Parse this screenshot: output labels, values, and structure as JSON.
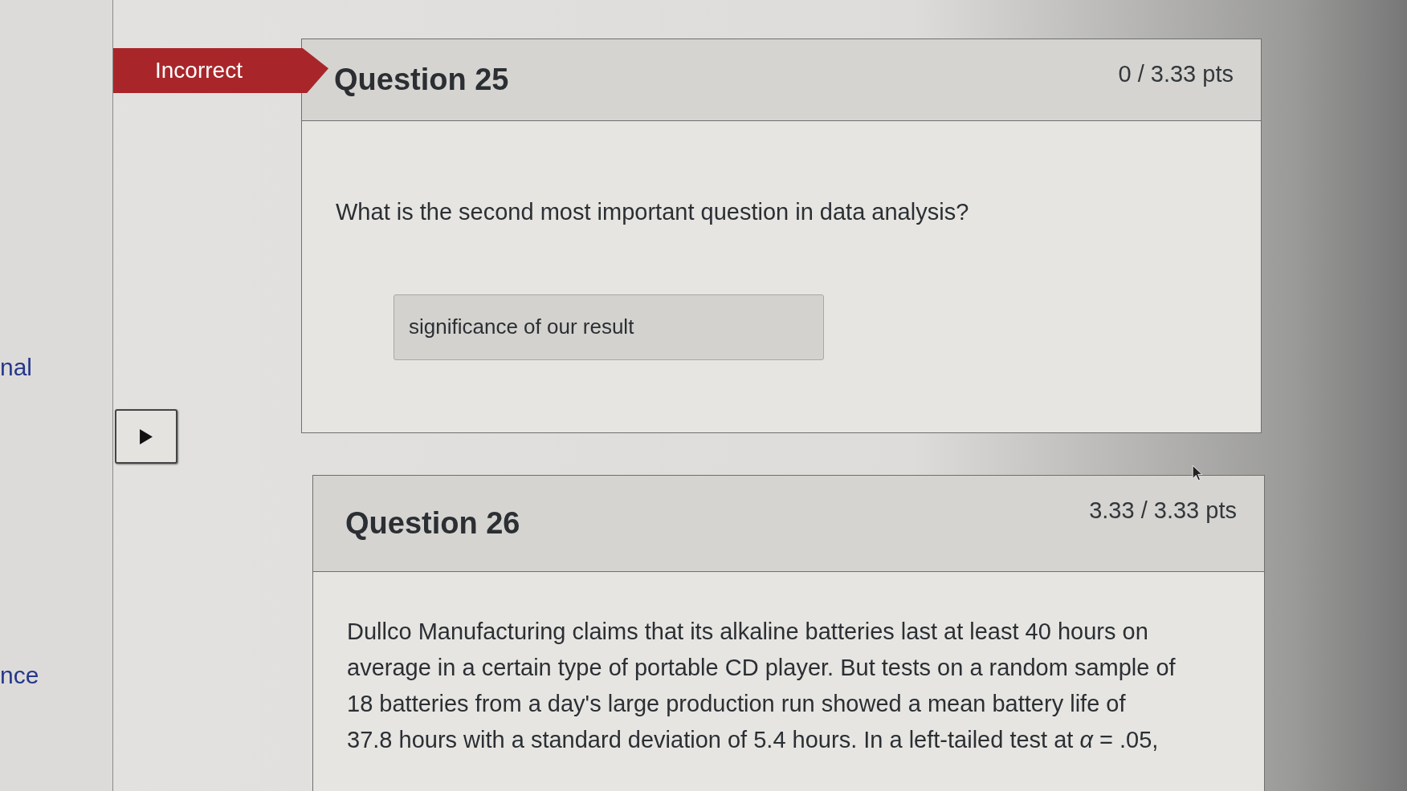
{
  "sidebar": {
    "links": [
      "nal",
      "nce"
    ]
  },
  "questions": [
    {
      "title": "Question 25",
      "points": "0 / 3.33 pts",
      "result_badge": "Incorrect",
      "text": "What is the second most important question in data analysis?",
      "answer": "significance of our result"
    },
    {
      "title": "Question 26",
      "points": "3.33 / 3.33 pts",
      "text": "Dullco Manufacturing claims that its alkaline batteries last at least 40 hours on average in a certain type of portable CD player. But tests on a random sample of 18 batteries from a day's large production run showed a mean battery life of 37.8 hours with a standard deviation of 5.4 hours. In a left-tailed test at *α* = .05,"
    }
  ]
}
